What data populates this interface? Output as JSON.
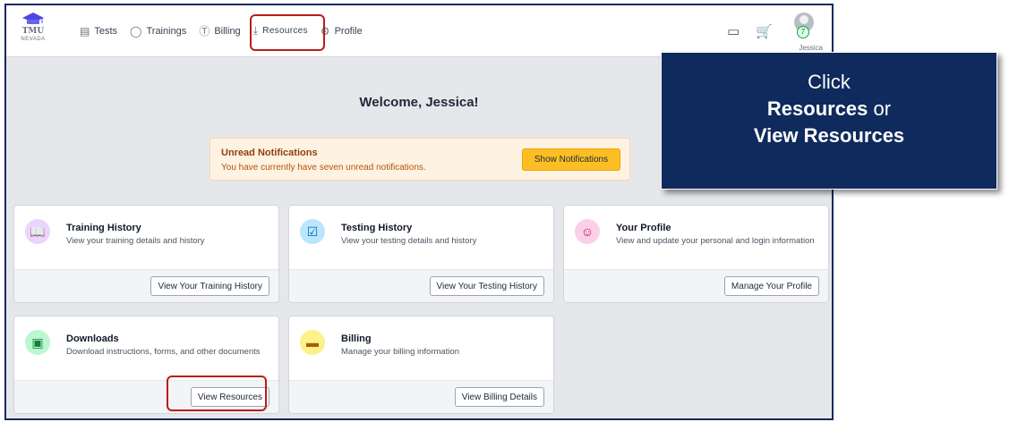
{
  "header": {
    "logo_top": "TMU",
    "logo_bottom": "NEVADA",
    "nav": [
      {
        "label": "Tests",
        "icon": "clipboard-icon"
      },
      {
        "label": "Trainings",
        "icon": "lightbulb-icon"
      },
      {
        "label": "Billing",
        "icon": "dollar-icon"
      },
      {
        "label": "Resources",
        "icon": "download-tray-icon"
      },
      {
        "label": "Profile",
        "icon": "gear-icon"
      }
    ],
    "icons": {
      "monitor": "monitor-icon",
      "cart": "cart-icon"
    },
    "user": {
      "name": "Jessica",
      "badge": "7"
    }
  },
  "main": {
    "welcome": "Welcome, Jessica!",
    "notification": {
      "title": "Unread Notifications",
      "message": "You have currently have seven unread notifications.",
      "button": "Show Notifications"
    },
    "cards": [
      {
        "title": "Training History",
        "desc": "View your training details and history",
        "button": "View Your Training History",
        "icon": "book-icon",
        "icon_color": "#e9d5ff"
      },
      {
        "title": "Testing History",
        "desc": "View your testing details and history",
        "button": "View Your Testing History",
        "icon": "clipboard-check-icon",
        "icon_color": "#bae6fd"
      },
      {
        "title": "Your Profile",
        "desc": "View and update your personal and login information",
        "button": "Manage Your Profile",
        "icon": "user-circle-icon",
        "icon_color": "#fbcfe8"
      },
      {
        "title": "Downloads",
        "desc": "Download instructions, forms, and other documents",
        "button": "View Resources",
        "icon": "archive-icon",
        "icon_color": "#bbf7d0"
      },
      {
        "title": "Billing",
        "desc": "Manage your billing information",
        "button": "View Billing Details",
        "icon": "credit-card-icon",
        "icon_color": "#fef08a"
      }
    ]
  },
  "callout": {
    "line1": "Click",
    "line2_bold": "Resources",
    "line2_rest": " or",
    "line3_bold": "View Resources"
  },
  "colors": {
    "highlight": "#b91c1c",
    "callout_bg": "#0f2a5c",
    "notification_button": "#fbbf24"
  }
}
